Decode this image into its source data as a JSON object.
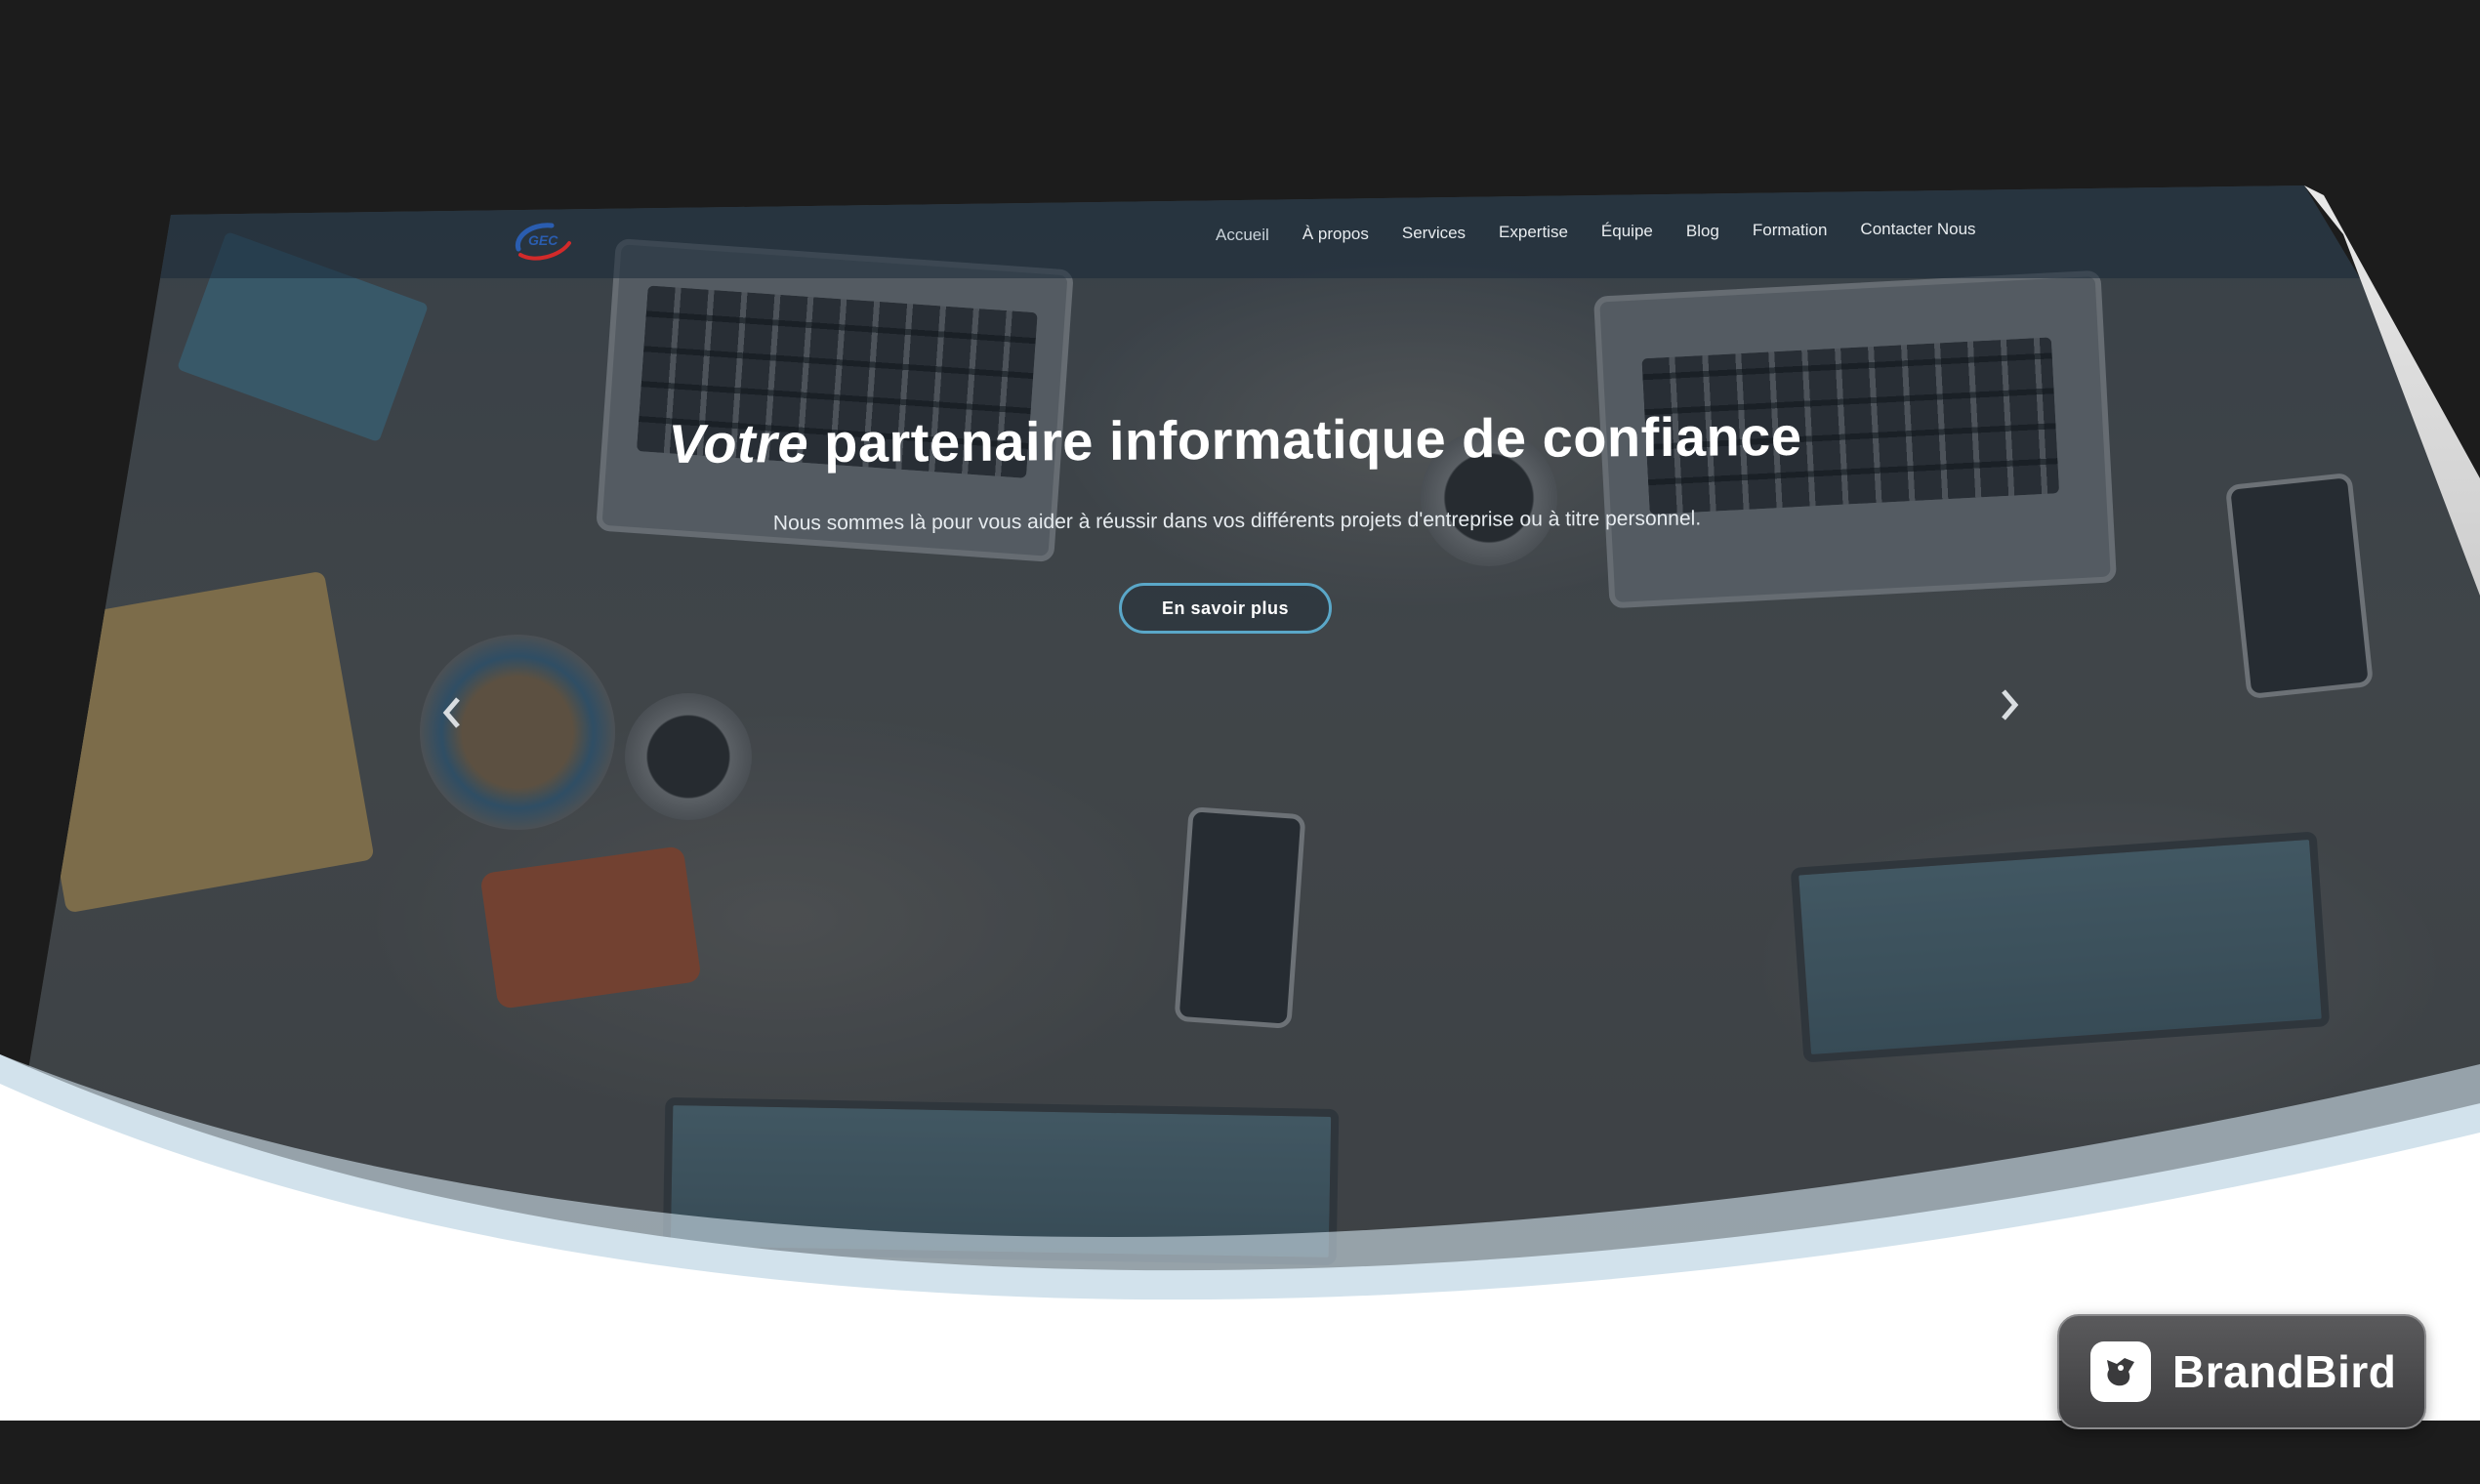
{
  "navbar": {
    "logo_alt": "GEC",
    "items": [
      {
        "label": "Accueil",
        "active": true
      },
      {
        "label": "À propos"
      },
      {
        "label": "Services"
      },
      {
        "label": "Expertise"
      },
      {
        "label": "Équipe"
      },
      {
        "label": "Blog"
      },
      {
        "label": "Formation"
      },
      {
        "label": "Contacter Nous"
      }
    ]
  },
  "hero": {
    "title_first": "Votre",
    "title_rest": " partenaire informatique de confiance",
    "subtitle": "Nous sommes là pour vous aider à réussir dans vos différents projets d'entreprise ou à titre personnel.",
    "cta_label": "En savoir plus",
    "prev_icon": "chevron-left-icon",
    "next_icon": "chevron-right-icon"
  },
  "badge": {
    "name": "BrandBird",
    "icon": "brandbird-logo-icon"
  },
  "colors": {
    "page_bg": "#1c1c1c",
    "cta_border": "#5aa7c8",
    "curve_light": "#d2e2ec",
    "logo_blue": "#2a5db0",
    "logo_red": "#d22a2a"
  }
}
